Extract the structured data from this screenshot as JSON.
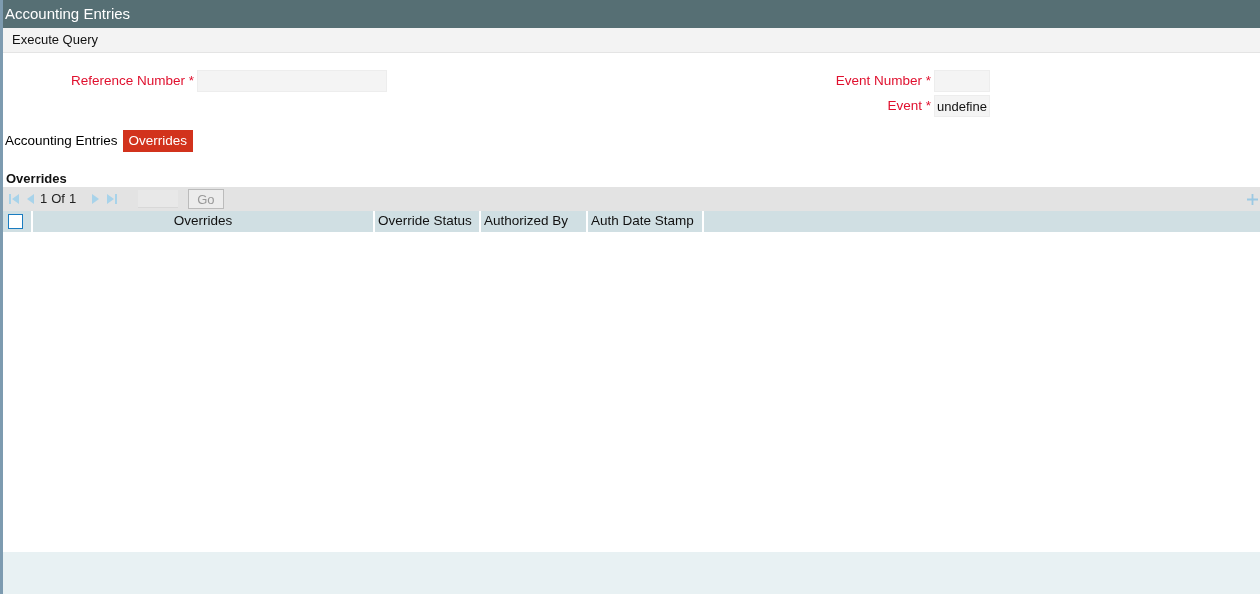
{
  "window": {
    "title": "Accounting Entries"
  },
  "toolbar": {
    "action": "Execute Query"
  },
  "left_fields": [
    {
      "label": "Reference Number",
      "required_mark": "*"
    }
  ],
  "right_fields": [
    {
      "label": "Event Number",
      "required_mark": "*"
    },
    {
      "label": "Event",
      "required_mark": "*",
      "value": "undefine"
    }
  ],
  "tabs": [
    {
      "label": "Accounting Entries",
      "selected": false
    },
    {
      "label": "Overrides",
      "selected": true
    }
  ],
  "section": {
    "title": "Overrides"
  },
  "pager": {
    "current": "1",
    "of": "Of",
    "total": "1",
    "go": "Go",
    "go_disabled": true
  },
  "table": {
    "select_all_checked": false,
    "columns": [
      "Overrides",
      "Override Status",
      "Authorized By",
      "Auth Date Stamp"
    ]
  }
}
